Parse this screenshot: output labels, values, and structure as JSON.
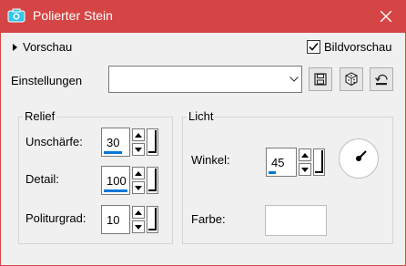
{
  "window": {
    "title": "Polierter Stein"
  },
  "preview": {
    "toggle_label": "Vorschau",
    "checkbox_label": "Bildvorschau",
    "checked": true
  },
  "settings": {
    "label": "Einstellungen",
    "value": ""
  },
  "relief": {
    "title": "Relief",
    "blur": {
      "label": "Unschärfe:",
      "value": "30"
    },
    "detail": {
      "label": "Detail:",
      "value": "100"
    },
    "polish": {
      "label": "Politurgrad:",
      "value": "10"
    }
  },
  "light": {
    "title": "Licht",
    "angle": {
      "label": "Winkel:",
      "value": "45"
    },
    "color": {
      "label": "Farbe:",
      "value": "#ffffff"
    }
  },
  "colors": {
    "titlebar": "#d64545",
    "accent": "#0078d7"
  },
  "icons": [
    "camera-icon",
    "close-icon",
    "save-icon",
    "randomize-icon",
    "reset-icon"
  ]
}
